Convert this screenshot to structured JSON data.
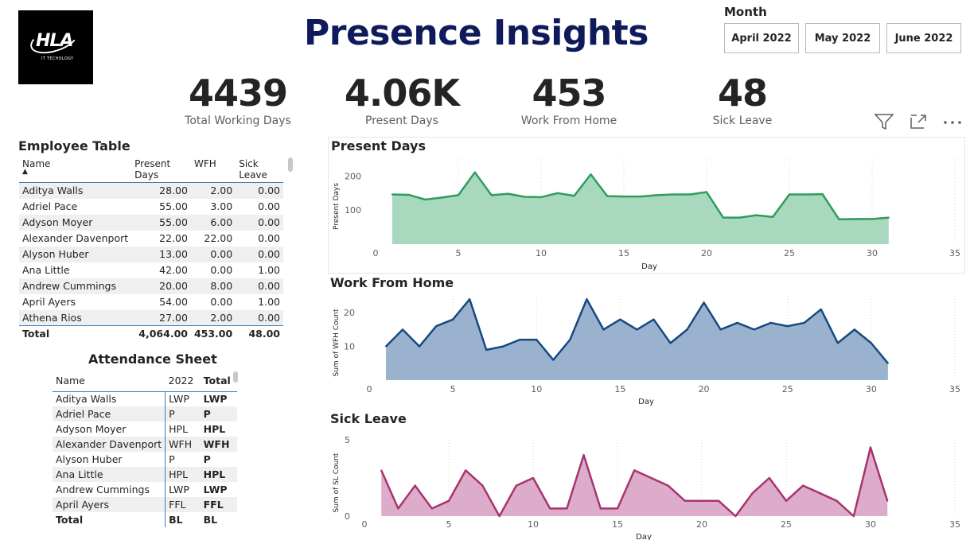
{
  "logo": {
    "mark": "HLA",
    "sub": "IT TECHOLOGY"
  },
  "title": "Presence Insights",
  "month_slicer": {
    "label": "Month",
    "options": [
      "April 2022",
      "May 2022",
      "June 2022"
    ]
  },
  "kpis": [
    {
      "value": "4439",
      "label": "Total Working Days"
    },
    {
      "value": "4.06K",
      "label": "Present Days"
    },
    {
      "value": "453",
      "label": "Work From Home"
    },
    {
      "value": "48",
      "label": "Sick Leave"
    }
  ],
  "toolbar": {
    "icons": [
      "filter-icon",
      "focus-mode-icon",
      "more-options-icon"
    ]
  },
  "employee_table": {
    "title": "Employee Table",
    "columns": [
      "Name",
      "Present Days",
      "WFH",
      "Sick Leave"
    ],
    "rows": [
      [
        "Aditya Walls",
        "28.00",
        "2.00",
        "0.00"
      ],
      [
        "Adriel Pace",
        "55.00",
        "3.00",
        "0.00"
      ],
      [
        "Adyson Moyer",
        "55.00",
        "6.00",
        "0.00"
      ],
      [
        "Alexander Davenport",
        "22.00",
        "22.00",
        "0.00"
      ],
      [
        "Alyson Huber",
        "13.00",
        "0.00",
        "0.00"
      ],
      [
        "Ana Little",
        "42.00",
        "0.00",
        "1.00"
      ],
      [
        "Andrew Cummings",
        "20.00",
        "8.00",
        "0.00"
      ],
      [
        "April Ayers",
        "54.00",
        "0.00",
        "1.00"
      ],
      [
        "Athena Rios",
        "27.00",
        "2.00",
        "0.00"
      ]
    ],
    "total": [
      "Total",
      "4,064.00",
      "453.00",
      "48.00"
    ]
  },
  "attendance_sheet": {
    "title": "Attendance Sheet",
    "columns": [
      "Name",
      "2022",
      "Total"
    ],
    "rows": [
      [
        "Aditya Walls",
        "LWP",
        "LWP"
      ],
      [
        "Adriel Pace",
        "P",
        "P"
      ],
      [
        "Adyson Moyer",
        "HPL",
        "HPL"
      ],
      [
        "Alexander Davenport",
        "WFH",
        "WFH"
      ],
      [
        "Alyson Huber",
        "P",
        "P"
      ],
      [
        "Ana Little",
        "HPL",
        "HPL"
      ],
      [
        "Andrew Cummings",
        "LWP",
        "LWP"
      ],
      [
        "April Ayers",
        "FFL",
        "FFL"
      ]
    ],
    "total": [
      "Total",
      "BL",
      "BL"
    ]
  },
  "chart_data": [
    {
      "type": "area",
      "title": "Present Days",
      "xlabel": "Day",
      "ylabel": "Present Days",
      "xlim": [
        0,
        35
      ],
      "ylim": [
        0,
        250
      ],
      "xticks": [
        0,
        5,
        10,
        15,
        20,
        25,
        30,
        35
      ],
      "yticks": [
        100,
        200
      ],
      "color": "#2e9c5e",
      "fill": "#a8d8bd",
      "x": [
        1,
        2,
        3,
        4,
        5,
        6,
        7,
        8,
        9,
        10,
        11,
        12,
        13,
        14,
        15,
        16,
        17,
        18,
        19,
        20,
        21,
        22,
        23,
        24,
        25,
        26,
        27,
        28,
        29,
        30,
        31
      ],
      "values": [
        146,
        145,
        131,
        137,
        144,
        211,
        144,
        148,
        139,
        138,
        150,
        142,
        205,
        141,
        140,
        140,
        144,
        146,
        146,
        153,
        78,
        78,
        85,
        80,
        146,
        146,
        147,
        73,
        74,
        74,
        78
      ]
    },
    {
      "type": "area",
      "title": "Work From Home",
      "xlabel": "Day",
      "ylabel": "Sum of WFH Count",
      "xlim": [
        0,
        35
      ],
      "ylim": [
        0,
        25
      ],
      "xticks": [
        0,
        5,
        10,
        15,
        20,
        25,
        30,
        35
      ],
      "yticks": [
        10,
        20
      ],
      "color": "#154a80",
      "fill": "#9bb2cf",
      "x": [
        1,
        2,
        3,
        4,
        5,
        6,
        7,
        8,
        9,
        10,
        11,
        12,
        13,
        14,
        15,
        16,
        17,
        18,
        19,
        20,
        21,
        22,
        23,
        24,
        25,
        26,
        27,
        28,
        29,
        30,
        31
      ],
      "values": [
        10,
        15,
        10,
        16,
        18,
        24,
        9,
        10,
        12,
        12,
        6,
        12,
        24,
        15,
        18,
        15,
        18,
        11,
        15,
        23,
        15,
        17,
        15,
        17,
        16,
        17,
        21,
        11,
        15,
        11,
        5
      ]
    },
    {
      "type": "area",
      "title": "Sick Leave",
      "xlabel": "Day",
      "ylabel": "Sum of SL Count",
      "xlim": [
        0,
        35
      ],
      "ylim": [
        0,
        5
      ],
      "xticks": [
        0,
        5,
        10,
        15,
        20,
        25,
        30,
        35
      ],
      "yticks": [
        0,
        5
      ],
      "color": "#a8346e",
      "fill": "#ddaccb",
      "x": [
        1,
        2,
        3,
        4,
        5,
        6,
        7,
        8,
        9,
        10,
        11,
        12,
        13,
        14,
        15,
        16,
        17,
        18,
        19,
        20,
        21,
        22,
        23,
        24,
        25,
        26,
        27,
        28,
        29,
        30,
        31
      ],
      "values": [
        3,
        0.5,
        2,
        0.5,
        1,
        3,
        2,
        0,
        2,
        2.5,
        0.5,
        0.5,
        4,
        0.5,
        0.5,
        3,
        2.5,
        2,
        1,
        1,
        1,
        0,
        1.5,
        2.5,
        1,
        2,
        1.5,
        1,
        0,
        4.5,
        1
      ]
    }
  ]
}
